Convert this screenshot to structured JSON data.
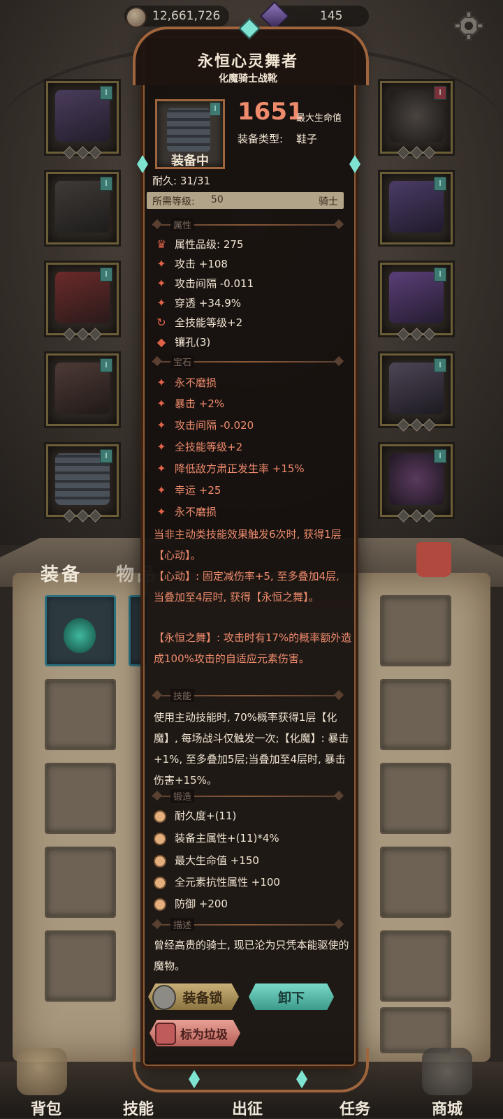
{
  "currency": {
    "coins": "12,661,726",
    "gems": "145"
  },
  "item": {
    "name": "永恒心灵舞者",
    "type_name": "化魔骑士战靴",
    "tag": "I",
    "stat_value": "1651",
    "stat_label": "最大生命值",
    "equip_type_label": "装备类型:",
    "equip_type_value": "鞋子",
    "equipped_label": "装备中",
    "durability": "耐久: 31/31",
    "req_label": "所需等级:",
    "req_value": "50",
    "req_class": "骑士"
  },
  "sections": {
    "attributes": "属性",
    "gems": "宝石",
    "skill": "技能",
    "forge": "锻造",
    "description": "描述"
  },
  "attributes": [
    {
      "icon": "quality-icon",
      "glyph": "♛",
      "text": "属性品级: 275"
    },
    {
      "icon": "attack-icon",
      "glyph": "✦",
      "text": "攻击 +108"
    },
    {
      "icon": "attack-speed-icon",
      "glyph": "✦",
      "text": "攻击间隔 -0.011"
    },
    {
      "icon": "pierce-icon",
      "glyph": "✦",
      "text": "穿透 +34.9%"
    },
    {
      "icon": "skill-level-icon",
      "glyph": "↻",
      "text": "全技能等级+2"
    },
    {
      "icon": "socket-icon",
      "glyph": "◆",
      "text": "镶孔(3)"
    }
  ],
  "gems": [
    "永不磨损",
    "暴击 +2%",
    "攻击间隔 -0.020",
    "全技能等级+2",
    "降低敌方肃正发生率 +15%",
    "幸运 +25",
    "永不磨损"
  ],
  "set_effect": [
    "当非主动类技能效果触发6次时, 获得1层【心动】。",
    "【心动】: 固定减伤率+5, 至多叠加4层, 当叠加至4层时, 获得【永恒之舞】。",
    "【永恒之舞】: 攻击时有17%的概率额外造成100%攻击的自适应元素伤害。"
  ],
  "skill_text": "使用主动技能时, 70%概率获得1层【化魔】, 每场战斗仅触发一次;【化魔】: 暴击+1%, 至多叠加5层;当叠加至4层时, 暴击伤害+15%。",
  "forge": [
    "耐久度+(11)",
    "装备主属性+(11)*4%",
    "最大生命值 +150",
    "全元素抗性属性 +100",
    "防御 +200"
  ],
  "description": "曾经高贵的骑士, 现已沦为只凭本能驱使的魔物。",
  "buttons": {
    "lock": "装备锁",
    "unequip": "卸下",
    "junk": "标为垃圾"
  },
  "inventory_tabs": {
    "equip": "装备",
    "items": "物品"
  },
  "nav": [
    "背包",
    "技能",
    "出征",
    "任务",
    "商城"
  ],
  "colors": {
    "accent_red": "#ef8b6d",
    "teal": "#7fe3d2",
    "frame_bronze": "#a0653d"
  }
}
